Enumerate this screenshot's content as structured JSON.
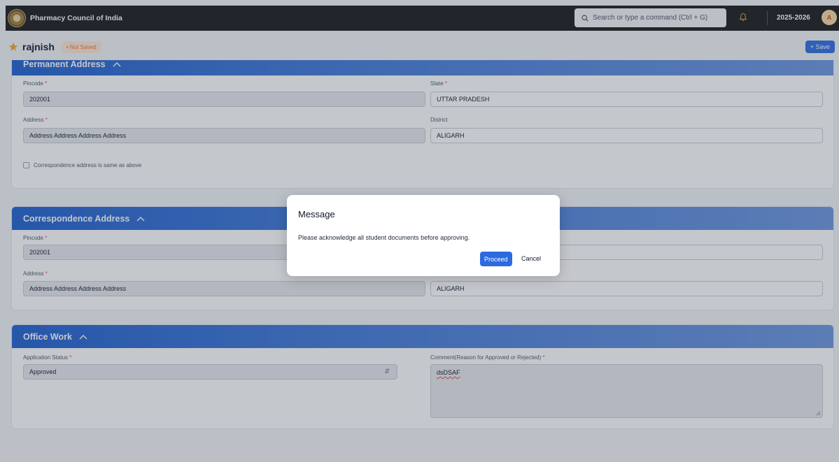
{
  "navbar": {
    "brand": "Pharmacy Council of India",
    "search_placeholder": "Search or type a command (Ctrl + G)",
    "year": "2025-2026",
    "avatar_initial": "A"
  },
  "header": {
    "title": "rajnish",
    "status_badge": "• Not Saved",
    "save_label": "+ Save"
  },
  "permanent_address": {
    "title": "Permanent Address",
    "pincode_label": "Pincode",
    "pincode_value": "202001",
    "state_label": "State",
    "state_value": "UTTAR PRADESH",
    "address_label": "Address",
    "address_value": "Address Address Address Address",
    "district_label": "District",
    "district_value": "ALIGARH",
    "same_as_label": "Correspondence address is same as above"
  },
  "correspondence_address": {
    "title": "Correspondence Address",
    "pincode_label": "Pincode",
    "pincode_value": "202001",
    "address_label": "Address",
    "address_value": "Address Address Address Address",
    "district_value": "ALIGARH"
  },
  "office_work": {
    "title": "Office Work",
    "status_label": "Application Status",
    "status_value": "Approved",
    "comment_label": "Comment(Reason for Approved or Rejected)",
    "comment_value": "dsDSAF"
  },
  "modal": {
    "title": "Message",
    "message": "Please acknowledge all student documents before approving.",
    "proceed_label": "Proceed",
    "cancel_label": "Cancel"
  },
  "required_marker": "*",
  "colors": {
    "accent": "#2b6ae0",
    "navbar": "#171717",
    "required": "#ef4444",
    "badge_text": "#f97316"
  }
}
